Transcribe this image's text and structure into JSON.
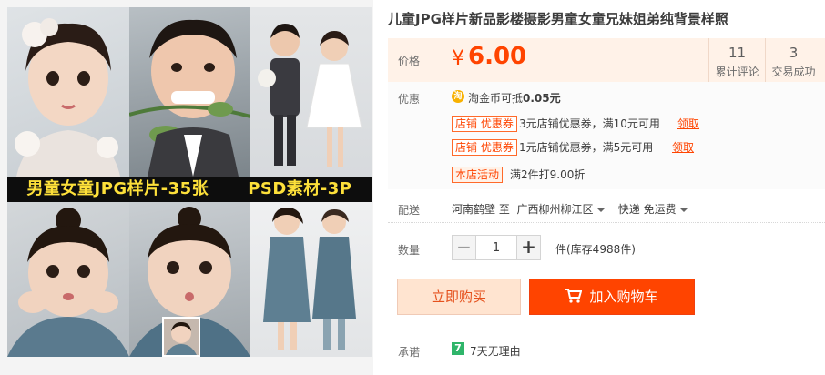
{
  "gallery": {
    "banner_left": "男童女童JPG样片-35张",
    "banner_right": "PSD素材-3P"
  },
  "product": {
    "title": "儿童JPG样片新品影楼摄影男童女童兄妹姐弟纯背景样照"
  },
  "price": {
    "label": "价格",
    "currency": "¥",
    "value": "6.00"
  },
  "stats": [
    {
      "value": "11",
      "label": "累计评论"
    },
    {
      "value": "3",
      "label": "交易成功"
    }
  ],
  "promo": {
    "label": "优惠",
    "coin_icon": "淘",
    "coin_text_prefix": "淘金币可抵",
    "coin_amount": "0.05元",
    "coupons": [
      {
        "tag": "店铺 优惠券",
        "text": "3元店铺优惠券，满10元可用",
        "link": "领取"
      },
      {
        "tag": "店铺 优惠券",
        "text": "1元店铺优惠券，满5元可用",
        "link": "领取"
      }
    ],
    "activity_tag": "本店活动",
    "activity_text": "满2件打9.00折"
  },
  "shipping": {
    "label": "配送",
    "from": "河南鹤壁",
    "to_word": "至",
    "dest": "广西柳州柳江区",
    "method": "快递 免运费"
  },
  "quantity": {
    "label": "数量",
    "minus": "−",
    "value": "1",
    "plus": "+",
    "stock": "件(库存4988件)"
  },
  "actions": {
    "buy_now": "立即购买",
    "add_to_cart": "加入购物车"
  },
  "promise": {
    "label": "承诺",
    "badge": "7",
    "text": "7天无理由"
  },
  "colors": {
    "accent": "#ff4400",
    "price_bg": "#fff2e8",
    "buy_bg": "#ffe4d0",
    "banner_text": "#fde03a"
  }
}
